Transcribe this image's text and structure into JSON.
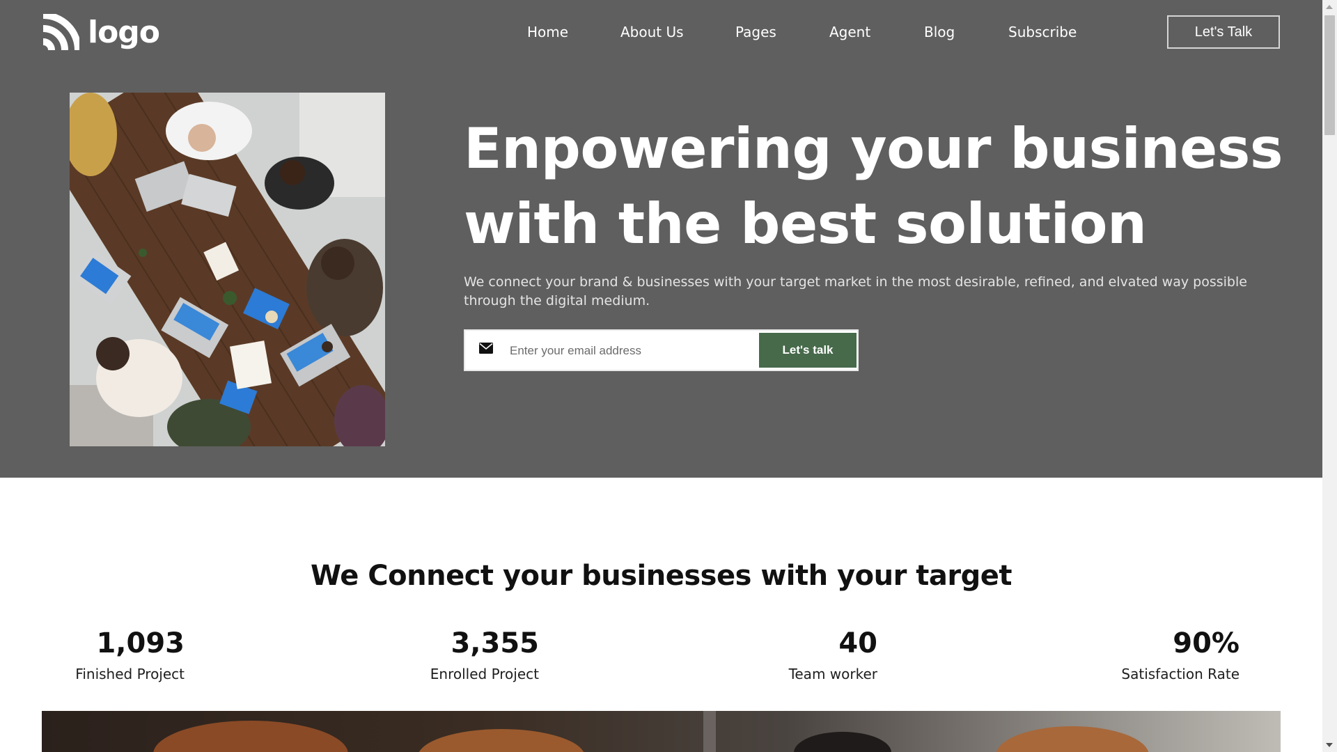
{
  "brand": {
    "logo_text": "logo"
  },
  "nav": {
    "items": [
      {
        "label": "Home"
      },
      {
        "label": "About Us"
      },
      {
        "label": "Pages"
      },
      {
        "label": "Agent"
      },
      {
        "label": "Blog"
      },
      {
        "label": "Subscribe"
      }
    ],
    "cta_label": "Let's Talk"
  },
  "hero": {
    "headline_line1": "Enpowering your business",
    "headline_line2": "with the best solution",
    "subtext": "We connect your brand & businesses with your target market in the most desirable, refined, and elvated way possible through the digital medium.",
    "email_placeholder": "Enter your email address",
    "email_button": "Let's talk"
  },
  "stats": {
    "title": "We Connect your businesses with your target",
    "items": [
      {
        "value": "1,093",
        "label": "Finished Project"
      },
      {
        "value": "3,355",
        "label": "Enrolled Project"
      },
      {
        "value": "40",
        "label": "Team worker"
      },
      {
        "value": "90%",
        "label": "Satisfaction Rate"
      }
    ]
  },
  "colors": {
    "hero_bg": "#5f5f5f",
    "accent_green": "#466a4a",
    "text_dark": "#111111"
  },
  "icons": {
    "logo": "logo-arcs-icon",
    "email": "envelope-icon"
  }
}
